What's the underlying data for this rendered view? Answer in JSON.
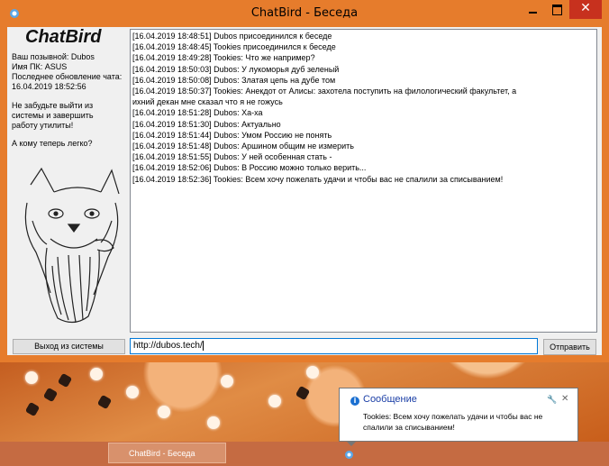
{
  "window": {
    "title": "ChatBird - Беседа",
    "close_glyph": "✕"
  },
  "sidebar": {
    "brand": "ChatBird",
    "info_lines": [
      "Ваш позывной: Dubos",
      "Имя ПК: ASUS",
      "Последнее обновление чата:",
      "16.04.2019 18:52:56"
    ],
    "reminder": [
      "Не забудьте выйти из",
      "системы и завершить",
      "работу утилиты!"
    ],
    "question": "А кому теперь легко?",
    "logout_label": "Выход из системы"
  },
  "chat": {
    "lines": [
      "[16.04.2019 18:48:51] Dubos присоединился к беседе",
      "[16.04.2019 18:48:45] Tookies присоединился к беседе",
      "[16.04.2019 18:49:28] Tookies: Что же например?",
      "[16.04.2019 18:50:03] Dubos: У лукоморья дуб зеленый",
      "[16.04.2019 18:50:08] Dubos: Златая цепь на дубе том",
      "[16.04.2019 18:50:37] Tookies: Анекдот от Алисы: захотела поступить на филологический факультет, а",
      "ихний декан мне сказал что я не гожусь",
      "[16.04.2019 18:51:28] Dubos: Ха-ха",
      "[16.04.2019 18:51:30] Dubos: Актуально",
      "[16.04.2019 18:51:44] Dubos: Умом Россию не понять",
      "[16.04.2019 18:51:48] Dubos: Аршином общим не измерить",
      "[16.04.2019 18:51:55] Dubos: У ней особенная стать -",
      "[16.04.2019 18:52:06] Dubos: В Россию можно только верить...",
      "[16.04.2019 18:52:36] Tookies: Всем хочу пожелать удачи и чтобы вас не спалили за списыванием!"
    ]
  },
  "composer": {
    "value": "http://dubos.tech/",
    "send_label": "Отправить"
  },
  "notification": {
    "title": "Сообщение",
    "text_lines": [
      "Tookies: Всем хочу пожелать удачи и чтобы вас не",
      "спалили за списыванием!"
    ],
    "info_glyph": "i",
    "close_glyph": "✕",
    "pin_glyph": "🔧"
  },
  "taskbar": {
    "item_label": "ChatBird - Беседа"
  },
  "colors": {
    "window_frame": "#e67c2c",
    "close_button": "#c7311e",
    "notification_title": "#1a3ea6",
    "input_focus_border": "#0078d7"
  }
}
